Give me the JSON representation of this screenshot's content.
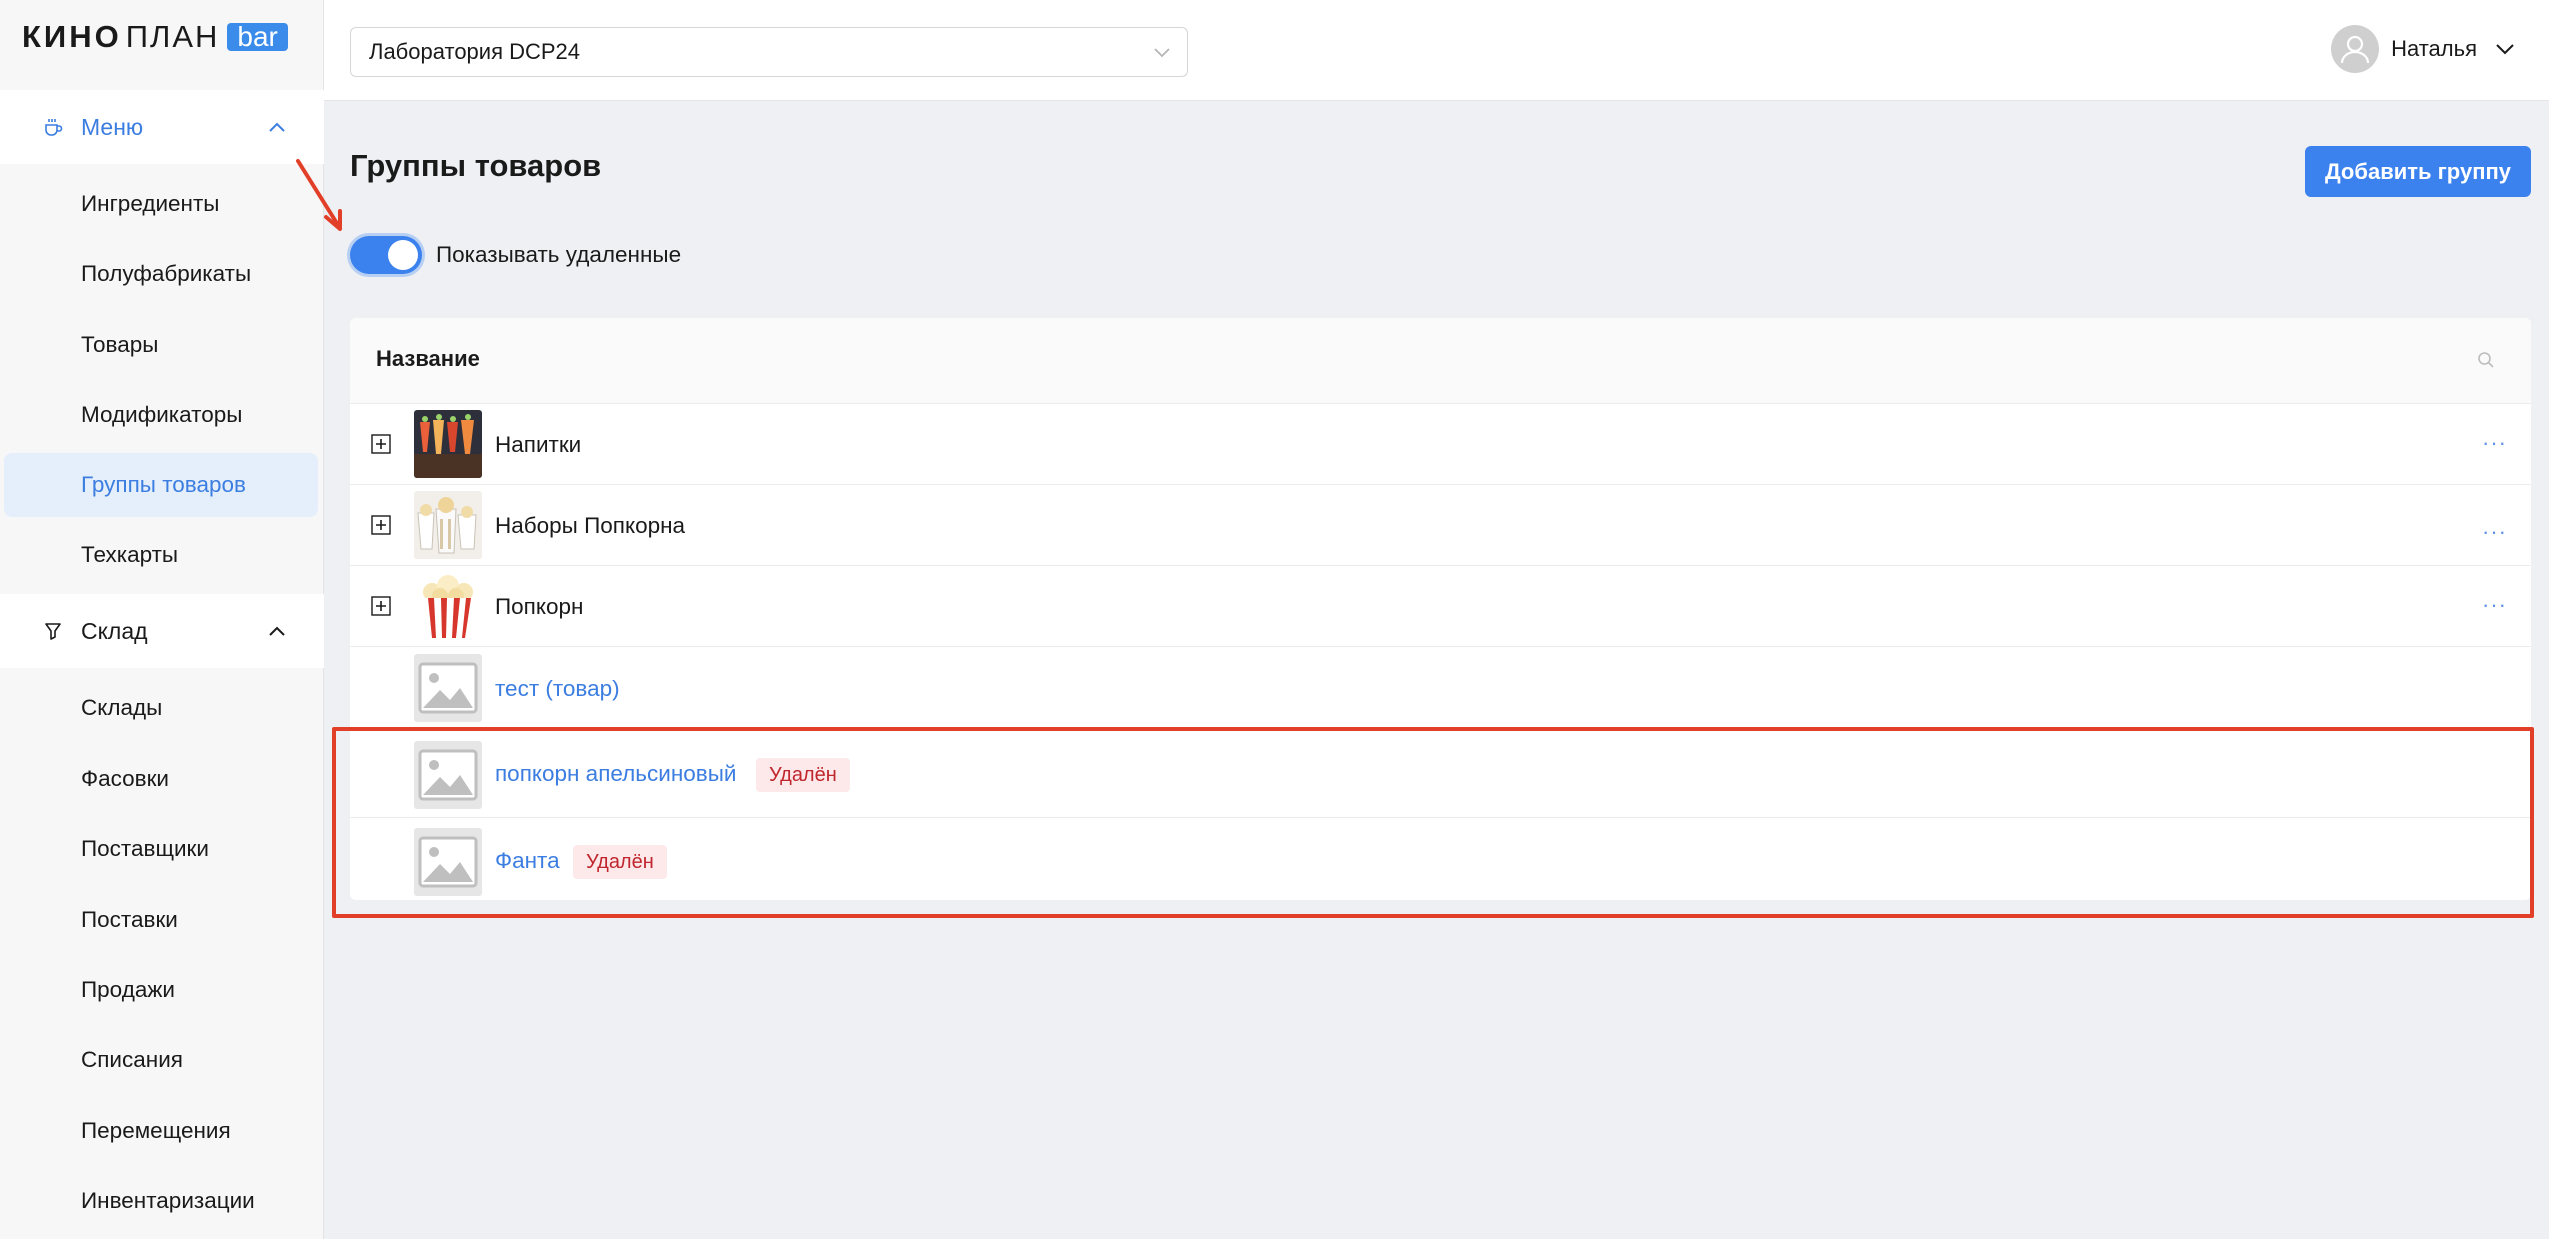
{
  "logo": {
    "part1": "КИНО",
    "part2": "ПЛАН",
    "badge": "bar"
  },
  "sidebar": {
    "menu_section": {
      "label": "Меню",
      "icon": "cup-icon"
    },
    "menu_items": [
      {
        "label": "Ингредиенты"
      },
      {
        "label": "Полуфабрикаты"
      },
      {
        "label": "Товары"
      },
      {
        "label": "Модификаторы"
      },
      {
        "label": "Группы товаров",
        "active": true
      },
      {
        "label": "Техкарты"
      }
    ],
    "sklad_section": {
      "label": "Склад",
      "icon": "funnel-glass-icon"
    },
    "sklad_items": [
      {
        "label": "Склады"
      },
      {
        "label": "Фасовки"
      },
      {
        "label": "Поставщики"
      },
      {
        "label": "Поставки"
      },
      {
        "label": "Продажи"
      },
      {
        "label": "Списания"
      },
      {
        "label": "Перемещения"
      },
      {
        "label": "Инвентаризации"
      }
    ]
  },
  "header": {
    "cinema_select": "Лаборатория DCP24",
    "user_name": "Наталья"
  },
  "main": {
    "title": "Группы товаров",
    "add_button": "Добавить группу",
    "toggle_label": "Показывать удаленные",
    "toggle_on": true,
    "table": {
      "column_name": "Название",
      "rows": [
        {
          "name": "Напитки",
          "expandable": true,
          "deleted": false,
          "actions": "···"
        },
        {
          "name": "Наборы Попкорна",
          "expandable": true,
          "deleted": false,
          "actions": "···"
        },
        {
          "name": "Попкорн",
          "expandable": true,
          "deleted": false,
          "actions": "···"
        },
        {
          "name": "тест (товар)",
          "expandable": false,
          "deleted": false
        },
        {
          "name": "попкорн апельсиновый",
          "expandable": false,
          "deleted": true,
          "tag": "Удалён"
        },
        {
          "name": "Фанта",
          "expandable": false,
          "deleted": true,
          "tag": "Удалён"
        }
      ]
    }
  },
  "colors": {
    "accent": "#3b82ee",
    "link": "#3b7de0",
    "deleted_tag_bg": "#fde8ea",
    "deleted_tag_text": "#c0262d",
    "annotation": "#e23f28"
  }
}
